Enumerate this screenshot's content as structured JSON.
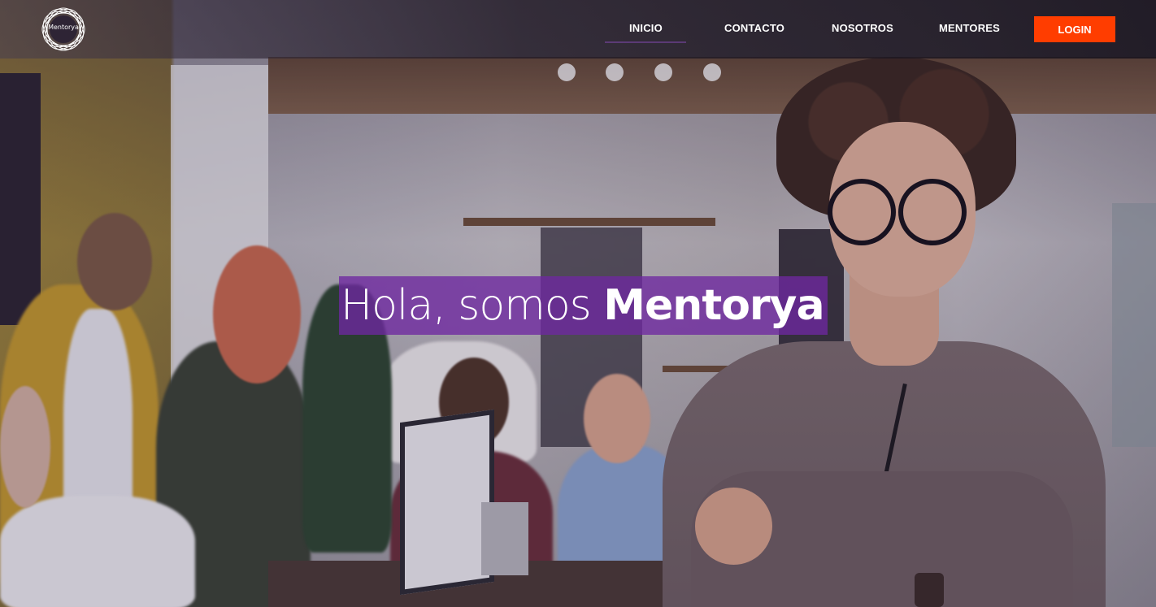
{
  "brand": {
    "logo_text": "Mentorya",
    "logo_icon": "circular-wave-emblem-icon"
  },
  "nav": {
    "items": [
      {
        "label": "INICIO",
        "active": true
      },
      {
        "label": "CONTACTO",
        "active": false
      },
      {
        "label": "NOSOTROS",
        "active": false
      },
      {
        "label": "MENTORES",
        "active": false
      }
    ],
    "login_label": "LOGIN"
  },
  "hero": {
    "title_prefix": "Hola, somos ",
    "title_brand": "Mentorya"
  },
  "colors": {
    "login_button": "#ff3d00",
    "title_highlight": "#6e28a0",
    "nav_text": "#ffffff"
  }
}
